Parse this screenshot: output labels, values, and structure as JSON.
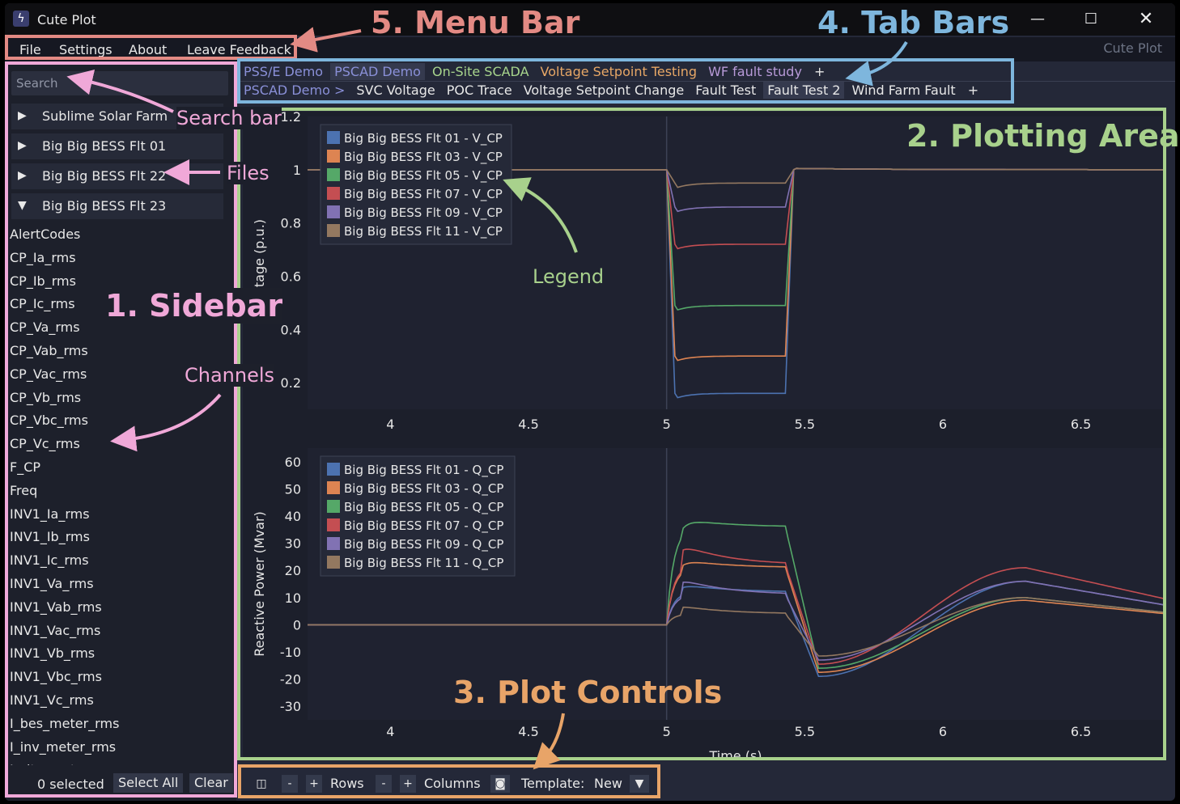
{
  "window": {
    "title": "Cute Plot",
    "brand": "Cute Plot"
  },
  "menu": [
    "File",
    "Settings",
    "About",
    "Leave Feedback"
  ],
  "sidebar": {
    "search_placeholder": "Search",
    "files": [
      {
        "name": "Sublime Solar Farm",
        "expanded": false
      },
      {
        "name": "Big Big BESS Flt 01",
        "expanded": false
      },
      {
        "name": "Big Big BESS Flt 22",
        "expanded": false
      },
      {
        "name": "Big Big BESS Flt 23",
        "expanded": true
      }
    ],
    "channels": [
      "AlertCodes",
      "CP_Ia_rms",
      "CP_Ib_rms",
      "CP_Ic_rms",
      "CP_Va_rms",
      "CP_Vab_rms",
      "CP_Vac_rms",
      "CP_Vb_rms",
      "CP_Vbc_rms",
      "CP_Vc_rms",
      "F_CP",
      "Freq",
      "INV1_Ia_rms",
      "INV1_Ib_rms",
      "INV1_Ic_rms",
      "INV1_Va_rms",
      "INV1_Vab_rms",
      "INV1_Vac_rms",
      "INV1_Vb_rms",
      "INV1_Vbc_rms",
      "INV1_Vc_rms",
      "I_bes_meter_rms",
      "I_inv_meter_rms",
      "I_site_meter_rms"
    ],
    "selected_count": "0 selected",
    "select_all": "Select All",
    "clear": "Clear"
  },
  "tabs_row1": [
    {
      "label": "PSS/E Demo",
      "color": "#8a90d8",
      "active": false
    },
    {
      "label": "PSCAD Demo",
      "color": "#8a90d8",
      "active": true
    },
    {
      "label": "On-Site SCADA",
      "color": "#a7d48c",
      "active": false
    },
    {
      "label": "Voltage Setpoint Testing",
      "color": "#e7a766",
      "active": false
    },
    {
      "label": "WF fault study",
      "color": "#b89ad8",
      "active": false
    }
  ],
  "tabs_row2": [
    {
      "label": "PSCAD Demo >",
      "color": "#8a90d8",
      "active": false
    },
    {
      "label": "SVC Voltage",
      "color": "#e8e8e8",
      "active": false
    },
    {
      "label": "POC Trace",
      "color": "#e8e8e8",
      "active": false
    },
    {
      "label": "Voltage Setpoint Change",
      "color": "#e8e8e8",
      "active": false
    },
    {
      "label": "Fault Test",
      "color": "#e8e8e8",
      "active": false
    },
    {
      "label": "Fault Test 2",
      "color": "#e8e8e8",
      "active": true
    },
    {
      "label": "Wind Farm Fault",
      "color": "#e8e8e8",
      "active": false
    }
  ],
  "tab_add": "+",
  "controls": {
    "minus": "-",
    "plus": "+",
    "rows": "Rows",
    "columns": "Columns",
    "template_label": "Template:",
    "template_value": "New"
  },
  "chart_data": [
    {
      "type": "line",
      "ylabel": "Voltage (p.u.)",
      "xlim": [
        3.7,
        6.8
      ],
      "ylim": [
        0.1,
        1.2
      ],
      "xticks": [
        "4",
        "4.5",
        "5",
        "5.5",
        "6",
        "6.5"
      ],
      "yticks": [
        "0.2",
        "0.4",
        "0.6",
        "0.8",
        "1",
        "1.2"
      ],
      "legend": "top-left",
      "series": [
        {
          "name": "Big Big BESS Flt 01 - V_CP",
          "color": "#4c72b0",
          "fault_level": 0.16
        },
        {
          "name": "Big Big BESS Flt 03 - V_CP",
          "color": "#dd8452",
          "fault_level": 0.3
        },
        {
          "name": "Big Big BESS Flt 05 - V_CP",
          "color": "#55a868",
          "fault_level": 0.49
        },
        {
          "name": "Big Big BESS Flt 07 - V_CP",
          "color": "#c44e52",
          "fault_level": 0.72
        },
        {
          "name": "Big Big BESS Flt 09 - V_CP",
          "color": "#8172b3",
          "fault_level": 0.86
        },
        {
          "name": "Big Big BESS Flt 11 - V_CP",
          "color": "#937860",
          "fault_level": 0.95
        }
      ]
    },
    {
      "type": "line",
      "ylabel": "Reactive Power (Mvar)",
      "xlabel": "Time (s)",
      "xlim": [
        3.7,
        6.8
      ],
      "ylim": [
        -35,
        65
      ],
      "xticks": [
        "4",
        "4.5",
        "5",
        "5.5",
        "6",
        "6.5"
      ],
      "yticks": [
        "60",
        "50",
        "40",
        "30",
        "20",
        "10",
        "0",
        "-10",
        "-20",
        "-30"
      ],
      "legend": "top-left",
      "series": [
        {
          "name": "Big Big BESS Flt 01 - Q_CP",
          "color": "#4c72b0",
          "fault_level": 12
        },
        {
          "name": "Big Big BESS Flt 03 - Q_CP",
          "color": "#dd8452",
          "fault_level": 21
        },
        {
          "name": "Big Big BESS Flt 05 - Q_CP",
          "color": "#55a868",
          "fault_level": 36
        },
        {
          "name": "Big Big BESS Flt 07 - Q_CP",
          "color": "#c44e52",
          "fault_level": 22
        },
        {
          "name": "Big Big BESS Flt 09 - Q_CP",
          "color": "#8172b3",
          "fault_level": 11
        },
        {
          "name": "Big Big BESS Flt 11 - Q_CP",
          "color": "#937860",
          "fault_level": 4
        }
      ]
    }
  ],
  "annotations": {
    "menu_bar": "5. Menu Bar",
    "tab_bars": "4. Tab Bars",
    "plotting_area": "2. Plotting Area",
    "plot_controls": "3. Plot Controls",
    "sidebar": "1. Sidebar",
    "search_bar": "Search bar",
    "files": "Files",
    "channels": "Channels",
    "legend": "Legend"
  }
}
